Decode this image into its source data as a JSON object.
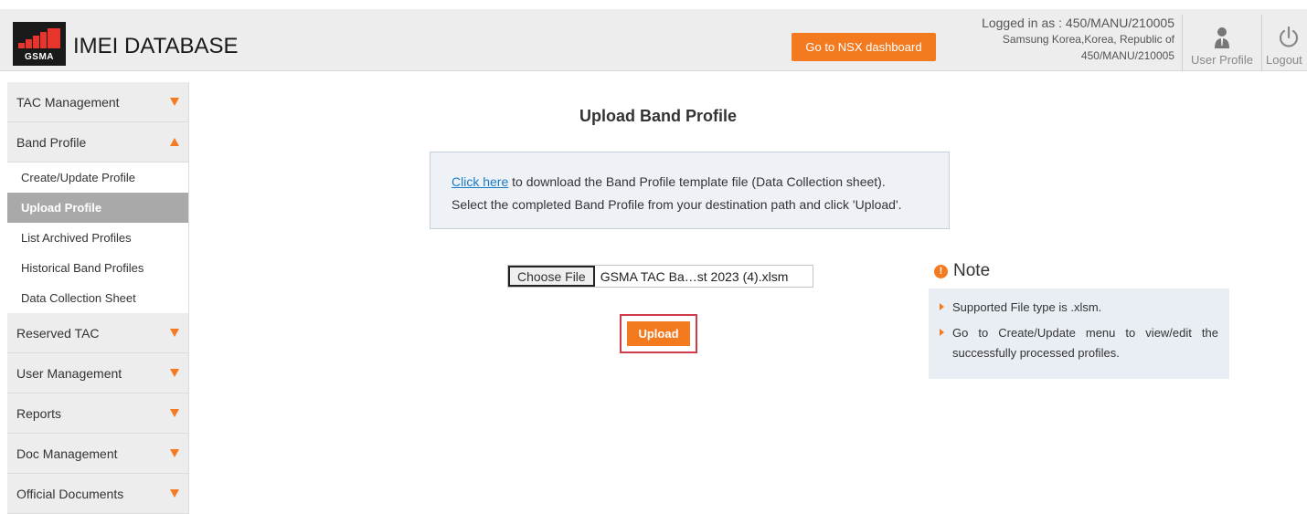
{
  "header": {
    "logo_text": "GSMA",
    "app_title": "IMEI DATABASE",
    "nsx_button": "Go to NSX dashboard",
    "login_line1": "Logged in as : 450/MANU/210005",
    "login_line2": "Samsung Korea,Korea, Republic of",
    "login_line3": "450/MANU/210005",
    "user_profile_label": "User Profile",
    "logout_label": "Logout",
    "colors": {
      "accent": "#f47a20",
      "logo_red": "#e8352b"
    }
  },
  "sidebar": {
    "tac_management": "TAC Management",
    "band_profile": "Band Profile",
    "band_profile_items": [
      "Create/Update Profile",
      "Upload Profile",
      "List Archived Profiles",
      "Historical Band Profiles",
      "Data Collection Sheet"
    ],
    "reserved_tac": "Reserved TAC",
    "user_management": "User Management",
    "reports": "Reports",
    "doc_management": "Doc Management",
    "official_documents": "Official Documents"
  },
  "main": {
    "title": "Upload Band Profile",
    "info_link": "Click here",
    "info_line1_rest": " to download the Band Profile template file (Data Collection sheet).",
    "info_line2": "Select the completed Band Profile from your destination path and click 'Upload'.",
    "choose_file_label": "Choose File",
    "file_name": "GSMA TAC Ba…st 2023 (4).xlsm",
    "upload_button": "Upload"
  },
  "note": {
    "title": "Note",
    "icon": "info-icon",
    "items": [
      "Supported File type is .xlsm.",
      "Go to Create/Update menu to view/edit the successfully processed profiles."
    ]
  }
}
